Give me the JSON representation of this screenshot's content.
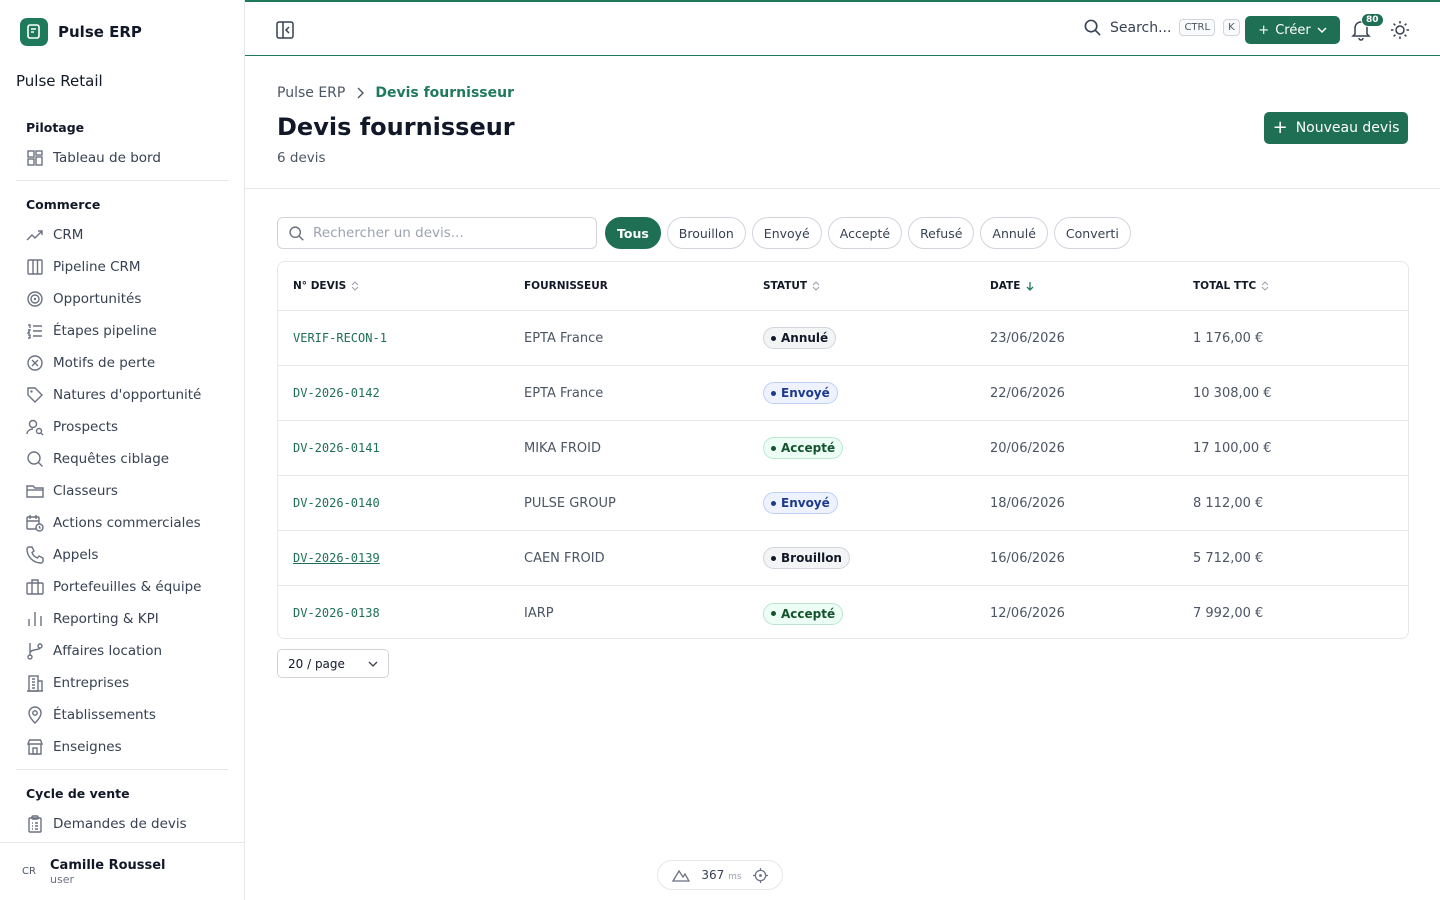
{
  "app": {
    "name": "Pulse ERP",
    "org": "Pulse Retail"
  },
  "sidebar": {
    "sections": [
      {
        "title": "Pilotage",
        "items": [
          {
            "label": "Tableau de bord",
            "icon": "dashboard-icon"
          }
        ]
      },
      {
        "title": "Commerce",
        "items": [
          {
            "label": "CRM",
            "icon": "trend-icon"
          },
          {
            "label": "Pipeline CRM",
            "icon": "columns-icon"
          },
          {
            "label": "Opportunités",
            "icon": "target-icon"
          },
          {
            "label": "Étapes pipeline",
            "icon": "list-ordered-icon"
          },
          {
            "label": "Motifs de perte",
            "icon": "x-circle-icon"
          },
          {
            "label": "Natures d'opportunité",
            "icon": "tag-icon"
          },
          {
            "label": "Prospects",
            "icon": "user-search-icon"
          },
          {
            "label": "Requêtes ciblage",
            "icon": "search-icon"
          },
          {
            "label": "Classeurs",
            "icon": "folder-icon"
          },
          {
            "label": "Actions commerciales",
            "icon": "calendar-clock-icon"
          },
          {
            "label": "Appels",
            "icon": "phone-icon"
          },
          {
            "label": "Portefeuilles & équipe",
            "icon": "briefcase-icon"
          },
          {
            "label": "Reporting & KPI",
            "icon": "bar-chart-icon"
          },
          {
            "label": "Affaires location",
            "icon": "git-branch-icon"
          },
          {
            "label": "Entreprises",
            "icon": "building-icon"
          },
          {
            "label": "Établissements",
            "icon": "map-pin-icon"
          },
          {
            "label": "Enseignes",
            "icon": "store-icon"
          }
        ]
      },
      {
        "title": "Cycle de vente",
        "items": [
          {
            "label": "Demandes de devis",
            "icon": "clipboard-icon"
          }
        ]
      }
    ]
  },
  "user": {
    "initials": "CR",
    "name": "Camille Roussel",
    "role": "user"
  },
  "topbar": {
    "search_label": "Search...",
    "kbd1": "CTRL",
    "kbd2": "K",
    "create_label": "Créer",
    "notif_count": "80"
  },
  "header": {
    "breadcrumb_root": "Pulse ERP",
    "breadcrumb_current": "Devis fournisseur",
    "title": "Devis fournisseur",
    "count": "6 devis",
    "new_button": "Nouveau devis"
  },
  "filters": {
    "search_placeholder": "Rechercher un devis...",
    "chips": [
      "Tous",
      "Brouillon",
      "Envoyé",
      "Accepté",
      "Refusé",
      "Annulé",
      "Converti"
    ],
    "active": "Tous"
  },
  "table": {
    "columns": [
      "N° DEVIS",
      "FOURNISSEUR",
      "STATUT",
      "DATE",
      "TOTAL TTC"
    ],
    "rows": [
      {
        "num": "VERIF-RECON-1",
        "supplier": "EPTA France",
        "status": "Annulé",
        "tone": "gray",
        "date": "23/06/2026",
        "total": "1 176,00 €"
      },
      {
        "num": "DV-2026-0142",
        "supplier": "EPTA France",
        "status": "Envoyé",
        "tone": "blue",
        "date": "22/06/2026",
        "total": "10 308,00 €"
      },
      {
        "num": "DV-2026-0141",
        "supplier": "MIKA FROID",
        "status": "Accepté",
        "tone": "green",
        "date": "20/06/2026",
        "total": "17 100,00 €"
      },
      {
        "num": "DV-2026-0140",
        "supplier": "PULSE GROUP",
        "status": "Envoyé",
        "tone": "blue",
        "date": "18/06/2026",
        "total": "8 112,00 €"
      },
      {
        "num": "DV-2026-0139",
        "supplier": "CAEN FROID",
        "status": "Brouillon",
        "tone": "gray",
        "date": "16/06/2026",
        "total": "5 712,00 €"
      },
      {
        "num": "DV-2026-0138",
        "supplier": "IARP",
        "status": "Accepté",
        "tone": "green",
        "date": "12/06/2026",
        "total": "7 992,00 €"
      }
    ]
  },
  "pagination": {
    "per_page": "20 / page"
  },
  "perf": {
    "value": "367",
    "unit": "ms"
  }
}
